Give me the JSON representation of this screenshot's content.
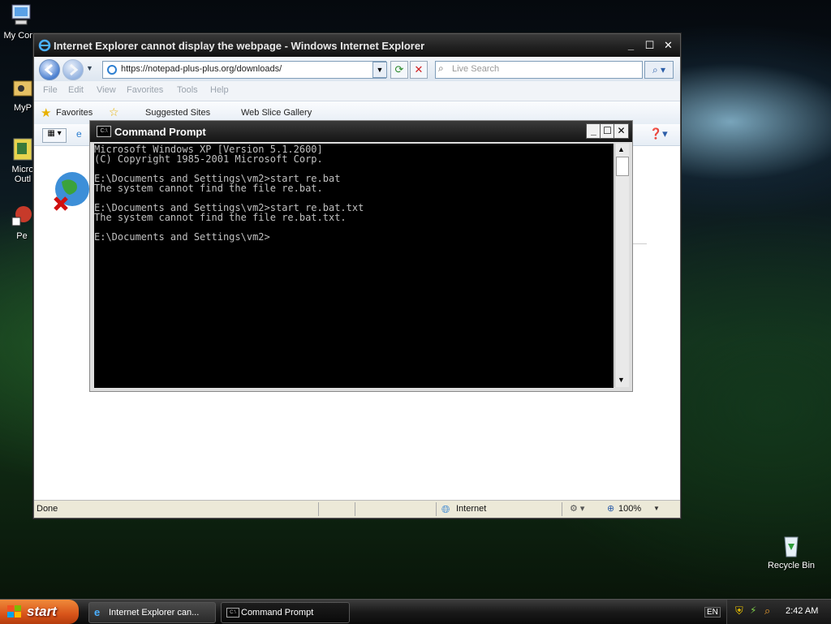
{
  "desktop": {
    "icons": [
      {
        "label": "My Com"
      },
      {
        "label": "MyP"
      },
      {
        "label": "Micro Outl"
      },
      {
        "label": "Pe"
      }
    ],
    "recycle_bin": "Recycle Bin"
  },
  "ie": {
    "title": "Internet Explorer cannot display the webpage - Windows Internet Explorer",
    "address": "https://notepad-plus-plus.org/downloads/",
    "search_placeholder": "Live Search",
    "menu": [
      "File",
      "Edit",
      "View",
      "Favorites",
      "Tools",
      "Help"
    ],
    "favorites": {
      "label": "Favorites",
      "suggested": "Suggested Sites",
      "webslice": "Web Slice Gallery"
    },
    "status": {
      "text": "Done",
      "zone": "Internet",
      "zoom": "100%"
    }
  },
  "cmd": {
    "title": "Command Prompt",
    "lines": [
      "Microsoft Windows XP [Version 5.1.2600]",
      "(C) Copyright 1985-2001 Microsoft Corp.",
      "",
      "E:\\Documents and Settings\\vm2>start re.bat",
      "The system cannot find the file re.bat.",
      "",
      "E:\\Documents and Settings\\vm2>start re.bat.txt",
      "The system cannot find the file re.bat.txt.",
      "",
      "E:\\Documents and Settings\\vm2>"
    ]
  },
  "taskbar": {
    "start": "start",
    "tasks": [
      {
        "label": "Internet Explorer can..."
      },
      {
        "label": "Command Prompt"
      }
    ],
    "lang": "EN",
    "clock": "2:42 AM"
  }
}
